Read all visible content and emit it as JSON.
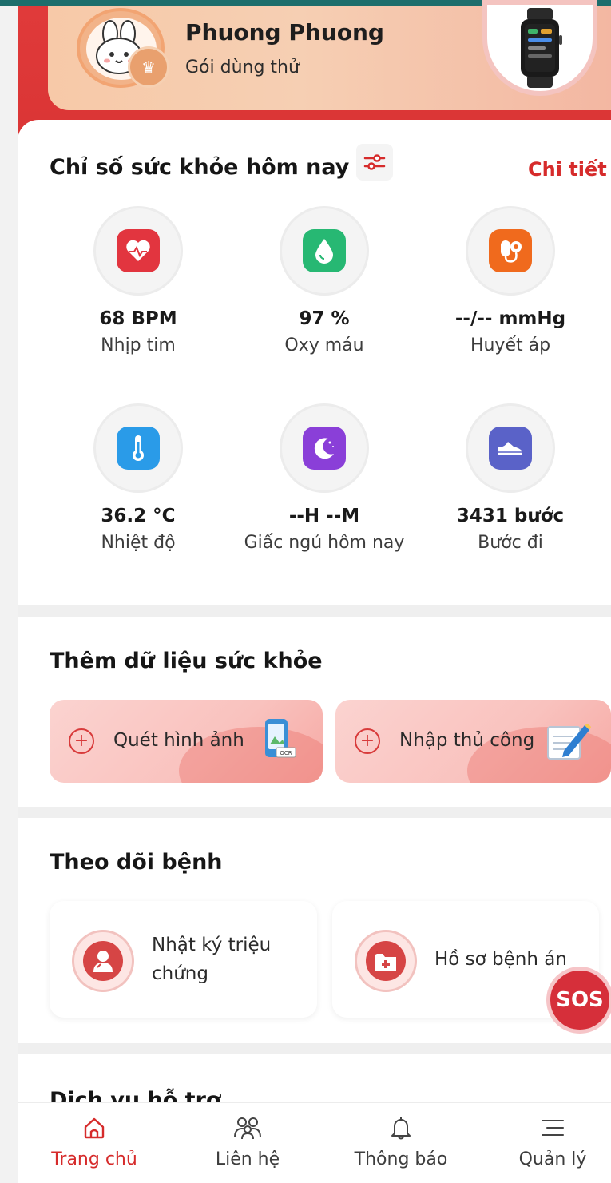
{
  "profile": {
    "name": "Phuong Phuong",
    "plan": "Gói dùng thử"
  },
  "health": {
    "title": "Chỉ số sức khỏe hôm nay",
    "detail_link": "Chi tiết",
    "metrics": [
      {
        "value": "68 BPM",
        "label": "Nhịp tim",
        "icon": "heart-rate-icon",
        "color": "#e2353f"
      },
      {
        "value": "97 %",
        "label": "Oxy máu",
        "icon": "blood-drop-icon",
        "color": "#27b873"
      },
      {
        "value": "--/-- mmHg",
        "label": "Huyết áp",
        "icon": "blood-pressure-icon",
        "color": "#f06a1d"
      },
      {
        "value": "36.2  °C",
        "label": "Nhiệt độ",
        "icon": "thermometer-icon",
        "color": "#2a9be8"
      },
      {
        "value": "--H --M",
        "label": "Giấc ngủ hôm nay",
        "icon": "moon-icon",
        "color": "#8a3fd8"
      },
      {
        "value": "3431 bước",
        "label": "Bước đi",
        "icon": "shoe-icon",
        "color": "#5a62c8"
      }
    ]
  },
  "add_data": {
    "title": "Thêm dữ liệu sức khỏe",
    "scan_label": "Quét hình ảnh",
    "manual_label": "Nhập thủ công",
    "ocr_tag": "OCR"
  },
  "disease": {
    "title": "Theo dõi bệnh",
    "symptom_line1": "Nhật ký triệu",
    "symptom_line2": "chứng",
    "record_label": "Hồ sơ bệnh án"
  },
  "sos_label": "SOS",
  "support_title": "Dịch vụ hỗ trợ",
  "nav": {
    "home": "Trang chủ",
    "contacts": "Liên hệ",
    "notifications": "Thông báo",
    "manage": "Quản lý"
  },
  "colors": {
    "accent": "#d62b2b",
    "header_red": "#e03a3a",
    "card_pink": "#fbd3d0"
  }
}
